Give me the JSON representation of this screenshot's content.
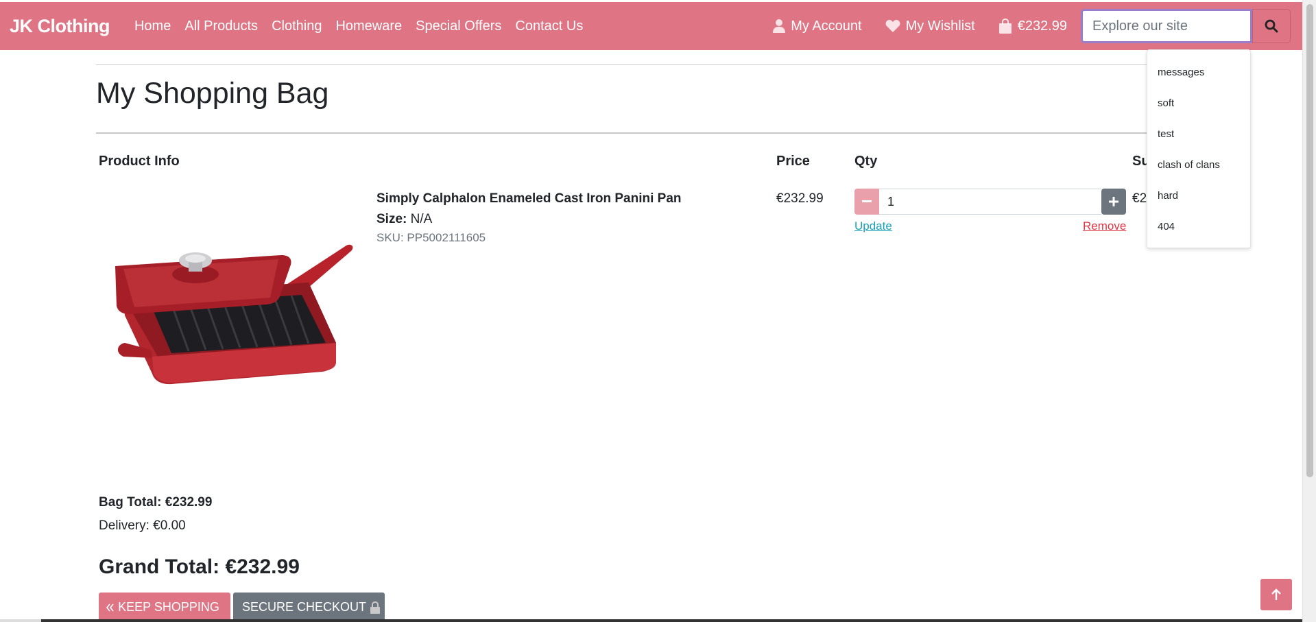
{
  "navbar": {
    "brand": "JK Clothing",
    "links": [
      "Home",
      "All Products",
      "Clothing",
      "Homeware",
      "Special Offers",
      "Contact Us"
    ],
    "account_label": "My Account",
    "wishlist_label": "My Wishlist",
    "bag_total": "€232.99",
    "search_placeholder": "Explore our site",
    "accent_color": "#df7584"
  },
  "search_suggestions": [
    "messages",
    "soft",
    "test",
    "clash of clans",
    "hard",
    "404"
  ],
  "page": {
    "title": "My Shopping Bag",
    "columns": {
      "product_info": "Product Info",
      "price": "Price",
      "qty": "Qty",
      "subtotal_partial": "Su"
    }
  },
  "item": {
    "name": "Simply Calphalon Enameled Cast Iron Panini Pan",
    "size_label": "Size:",
    "size_value": "N/A",
    "sku": "SKU: PP5002111605",
    "price": "€232.99",
    "quantity": "1",
    "update_label": "Update",
    "remove_label": "Remove",
    "subtotal_partial": "€2"
  },
  "totals": {
    "bag_total": "Bag Total: €232.99",
    "delivery": "Delivery: €0.00",
    "grand_total": "Grand Total: €232.99"
  },
  "buttons": {
    "keep_shopping": "KEEP SHOPPING",
    "secure_checkout": "SECURE CHECKOUT"
  },
  "icons": {
    "account": "user-icon",
    "wishlist": "heart-icon",
    "bag": "shopping-bag-icon",
    "search": "search-icon",
    "keep_shopping": "double-chevron-left-icon",
    "checkout": "lock-icon",
    "back_to_top": "arrow-up-icon"
  }
}
